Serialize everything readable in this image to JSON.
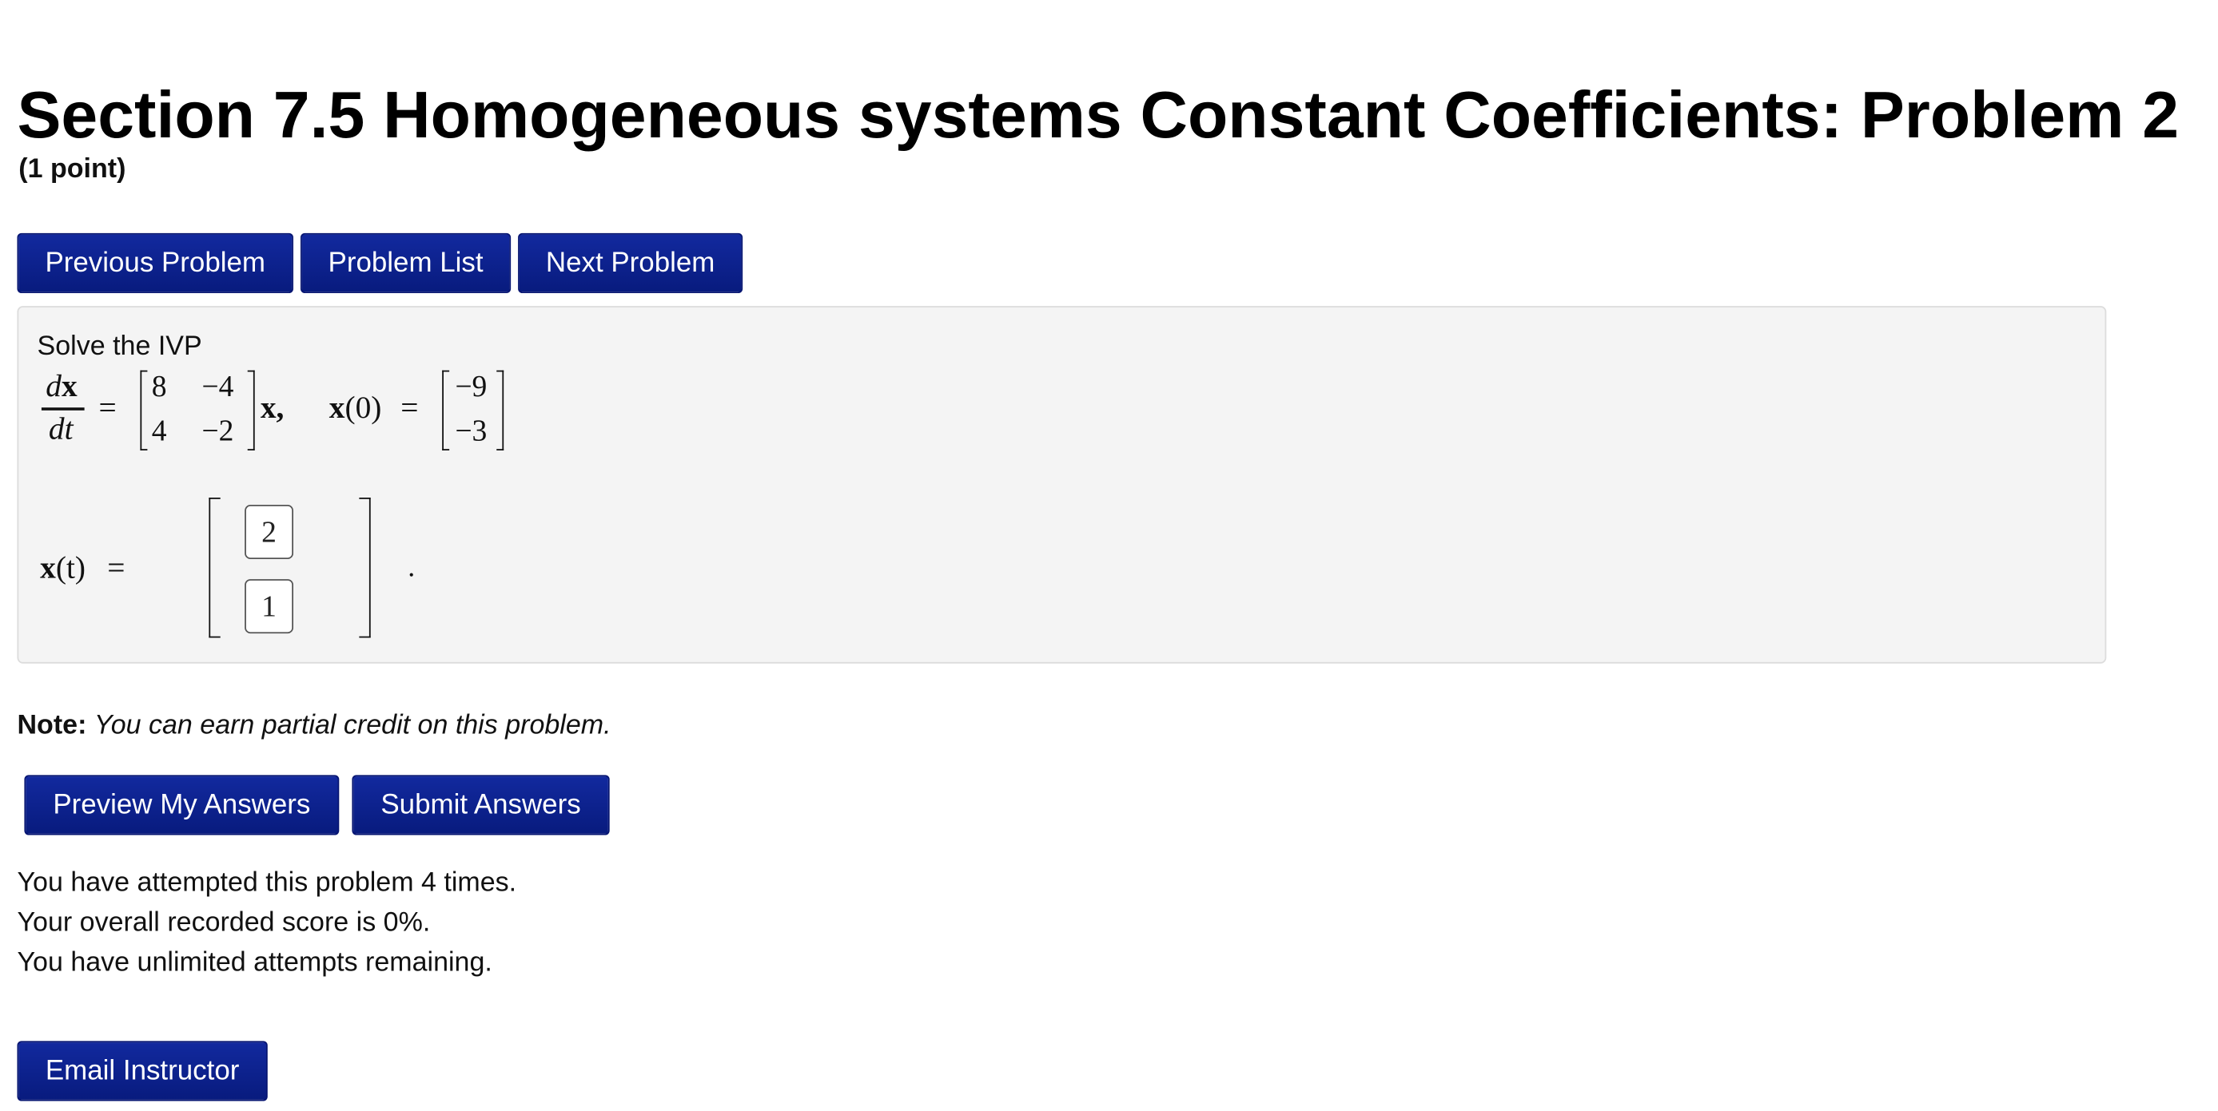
{
  "header": {
    "title": "Section 7.5 Homogeneous systems Constant Coefficients: Problem 2",
    "points": "(1 point)"
  },
  "nav": {
    "prev_label": "Previous Problem",
    "list_label": "Problem List",
    "next_label": "Next Problem"
  },
  "problem": {
    "intro": "Solve the IVP",
    "d": "d",
    "x_bold": "x",
    "dt": "dt",
    "equals": "=",
    "matrix": [
      [
        "8",
        "−4"
      ],
      [
        "4",
        "−2"
      ]
    ],
    "x_comma": "x,",
    "x0_x": "x",
    "x0_arg": "(0)",
    "x0_vector": [
      "−9",
      "−3"
    ],
    "answer_lhs_x": "x",
    "answer_lhs_arg": "(t)",
    "answer_values": [
      "2",
      "1"
    ],
    "period": "."
  },
  "note": {
    "label": "Note:",
    "text": "You can earn partial credit on this problem."
  },
  "actions": {
    "preview_label": "Preview My Answers",
    "submit_label": "Submit Answers"
  },
  "status": {
    "attempts": "You have attempted this problem 4 times.",
    "score": "Your overall recorded score is 0%.",
    "remaining": "You have unlimited attempts remaining."
  },
  "footer": {
    "email_label": "Email Instructor"
  }
}
